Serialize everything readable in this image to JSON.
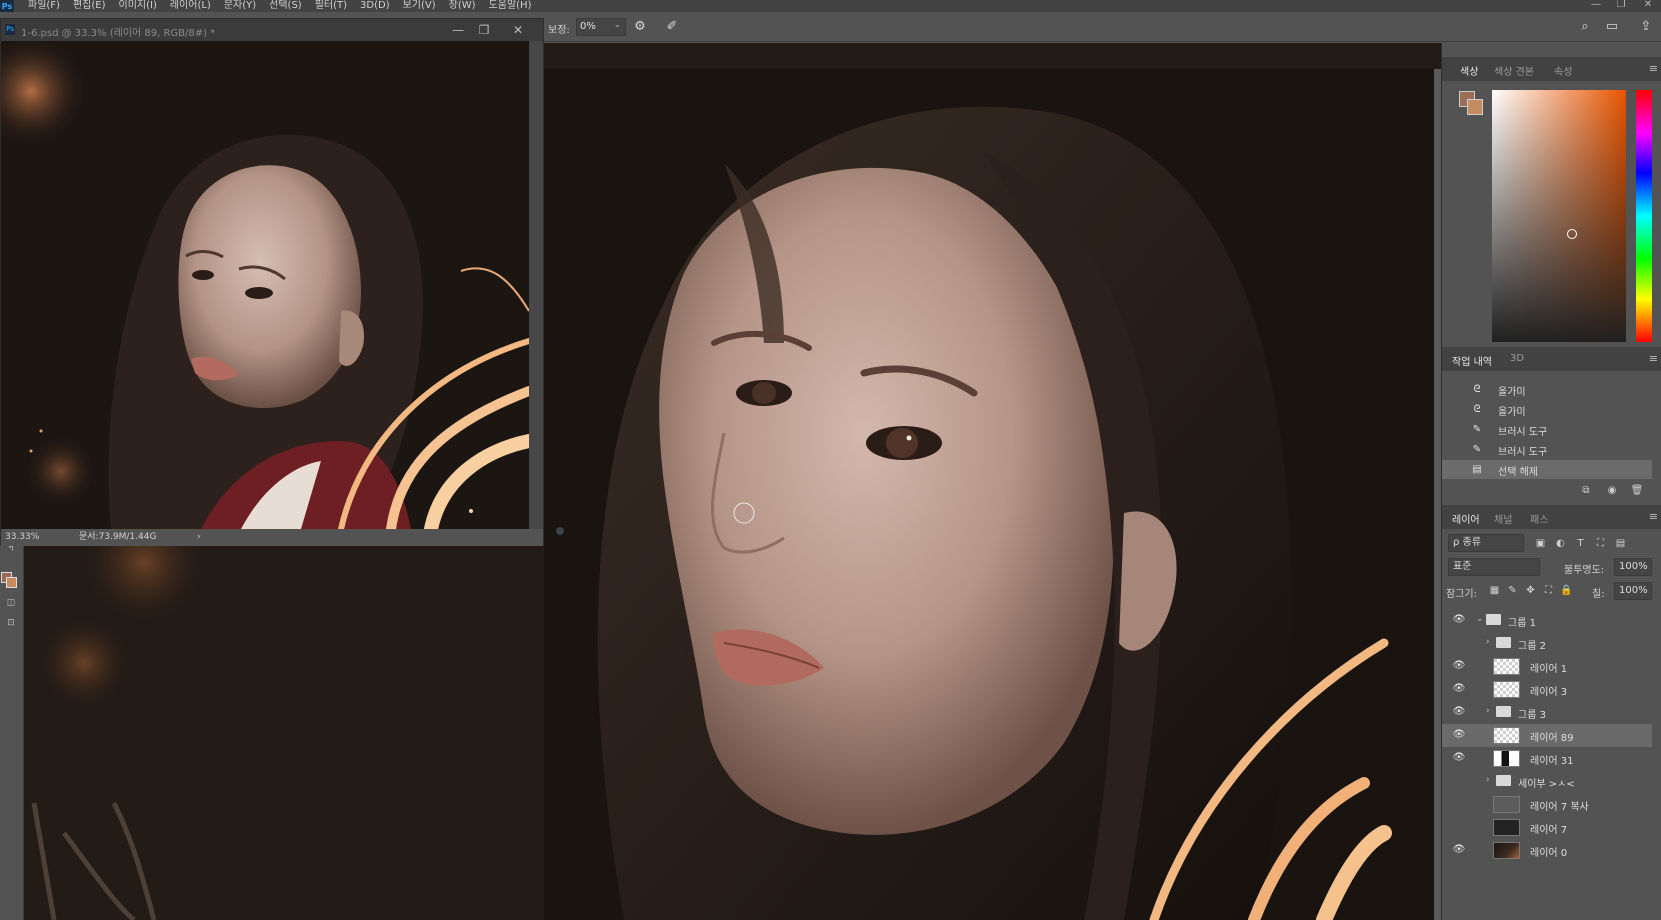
{
  "menubar": {
    "logo": "Ps",
    "items": [
      "파일(F)",
      "편집(E)",
      "이미지(I)",
      "레이어(L)",
      "문자(Y)",
      "선택(S)",
      "필터(T)",
      "3D(D)",
      "보기(V)",
      "창(W)",
      "도움말(H)"
    ],
    "minimize": "—",
    "restore": "❐",
    "close": "✕"
  },
  "options_bar": {
    "smoothing_label": "보정:",
    "smoothing_value": "0%",
    "dropdown": "⌄",
    "settings_icon": "gear-icon",
    "settings_glyph": "⚙",
    "pressure_icon": "pressure-brush-icon",
    "pressure_glyph": "✐",
    "search_glyph": "⌕",
    "workspace_glyph": "▭",
    "share_glyph": "⇪"
  },
  "doc_window": {
    "icon": "Ps",
    "title": "1-6.psd @ 33.3% (레이어 89, RGB/8#) *",
    "minimize": "—",
    "restore": "❐",
    "close": "✕",
    "zoom": "33.33%",
    "doc_size": "문서:73.9M/1.44G",
    "status_arrow": "›"
  },
  "toolbar": {
    "items": [
      "↰",
      "◫",
      "⊡"
    ]
  },
  "color_panel": {
    "tabs": [
      "색상",
      "색상 견본",
      "속성"
    ],
    "active_tab": 0,
    "foreground": "#9c6e58",
    "background": "#c58c62",
    "menu": "≡"
  },
  "history_panel": {
    "tabs": [
      "작업 내역",
      "3D"
    ],
    "active_tab": 0,
    "menu": "≡",
    "items": [
      {
        "icon": "lasso-icon",
        "glyph": "ᘓ",
        "label": "올가미"
      },
      {
        "icon": "lasso-icon",
        "glyph": "ᘓ",
        "label": "올가미"
      },
      {
        "icon": "brush-icon",
        "glyph": "✎",
        "label": "브러시 도구"
      },
      {
        "icon": "brush-icon",
        "glyph": "✎",
        "label": "브러시 도구"
      },
      {
        "icon": "document-icon",
        "glyph": "▤",
        "label": "선택 해제"
      }
    ],
    "selected": 4,
    "buttons": [
      "⧉",
      "◉",
      "🗑"
    ]
  },
  "layers_panel": {
    "tabs": [
      "레이어",
      "채널",
      "패스"
    ],
    "active_tab": 0,
    "menu": "≡",
    "filter_label": "ρ 종류",
    "filter_icons": [
      "▣",
      "◐",
      "T",
      "⛶",
      "▤"
    ],
    "blend_mode": "표준",
    "opacity_label": "불투명도:",
    "opacity_value": "100%",
    "lock_label": "잠그기:",
    "lock_icons": [
      "▦",
      "✎",
      "✥",
      "⛶",
      "🔒"
    ],
    "fill_label": "칠:",
    "fill_value": "100%",
    "eye": "👁",
    "layers": [
      {
        "name": "그룹 1",
        "type": "group",
        "visible": true,
        "indent": 0,
        "expanded": true
      },
      {
        "name": "그룹 2",
        "type": "group",
        "visible": false,
        "indent": 1,
        "expanded": false
      },
      {
        "name": "레이어 1",
        "type": "layer",
        "thumb": "checker",
        "visible": true,
        "indent": 1
      },
      {
        "name": "레이어 3",
        "type": "layer",
        "thumb": "checker",
        "visible": true,
        "indent": 1
      },
      {
        "name": "그룹 3",
        "type": "group",
        "visible": true,
        "indent": 1,
        "expanded": false
      },
      {
        "name": "레이어 89",
        "type": "layer",
        "thumb": "checker",
        "visible": true,
        "indent": 1,
        "selected": true
      },
      {
        "name": "레이어 31",
        "type": "layer",
        "thumb": "portrait",
        "visible": true,
        "indent": 1
      },
      {
        "name": "세이부 >ㅅ<",
        "type": "group",
        "visible": false,
        "indent": 1,
        "expanded": false
      },
      {
        "name": "레이어 7 복사",
        "type": "layer",
        "thumb": "gray",
        "visible": false,
        "indent": 1
      },
      {
        "name": "레이어 7",
        "type": "layer",
        "thumb": "dark",
        "visible": false,
        "indent": 1
      },
      {
        "name": "레이어 0",
        "type": "layer",
        "thumb": "art",
        "visible": true,
        "indent": 1
      }
    ]
  }
}
